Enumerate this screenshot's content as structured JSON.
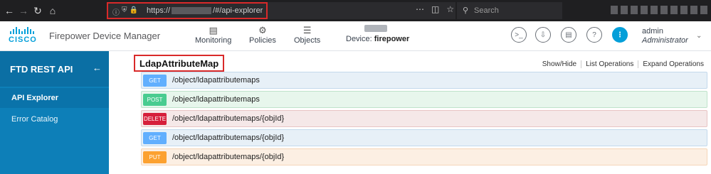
{
  "browser": {
    "url_prefix": "https://",
    "url_suffix": "/#/api-explorer",
    "search_placeholder": "Search",
    "icons": [
      "back-icon",
      "forward-icon",
      "reload-icon",
      "home-icon",
      "info-icon",
      "shield-icon",
      "lock-icon",
      "more-icon",
      "pocket-icon",
      "star-icon",
      "search-icon"
    ]
  },
  "header": {
    "brand_word": "CISCO",
    "app_title": "Firepower Device Manager",
    "nav": [
      {
        "label": "Monitoring",
        "icon": "monitoring-icon"
      },
      {
        "label": "Policies",
        "icon": "policies-icon"
      },
      {
        "label": "Objects",
        "icon": "objects-icon"
      }
    ],
    "device_label": "Device:",
    "device_name": "firepower",
    "user_name": "admin",
    "user_role": "Administrator"
  },
  "sidebar": {
    "title": "FTD REST API",
    "items": [
      {
        "label": "API Explorer",
        "active": true
      },
      {
        "label": "Error Catalog",
        "active": false
      }
    ]
  },
  "main": {
    "resource_title": "LdapAttributeMap",
    "links": [
      "Show/Hide",
      "List Operations",
      "Expand Operations"
    ],
    "operations": [
      {
        "method": "GET",
        "path": "/object/ldapattributemaps"
      },
      {
        "method": "POST",
        "path": "/object/ldapattributemaps"
      },
      {
        "method": "DELETE",
        "path": "/object/ldapattributemaps/{objId}"
      },
      {
        "method": "GET",
        "path": "/object/ldapattributemaps/{objId}"
      },
      {
        "method": "PUT",
        "path": "/object/ldapattributemaps/{objId}"
      }
    ]
  },
  "colors": {
    "sidebar": "#0d7fb8",
    "accent": "#049fd9",
    "highlight_border": "#d92a2a",
    "get": "#61affe",
    "post": "#49cc90",
    "delete": "#d61f3b",
    "put": "#fca130"
  }
}
